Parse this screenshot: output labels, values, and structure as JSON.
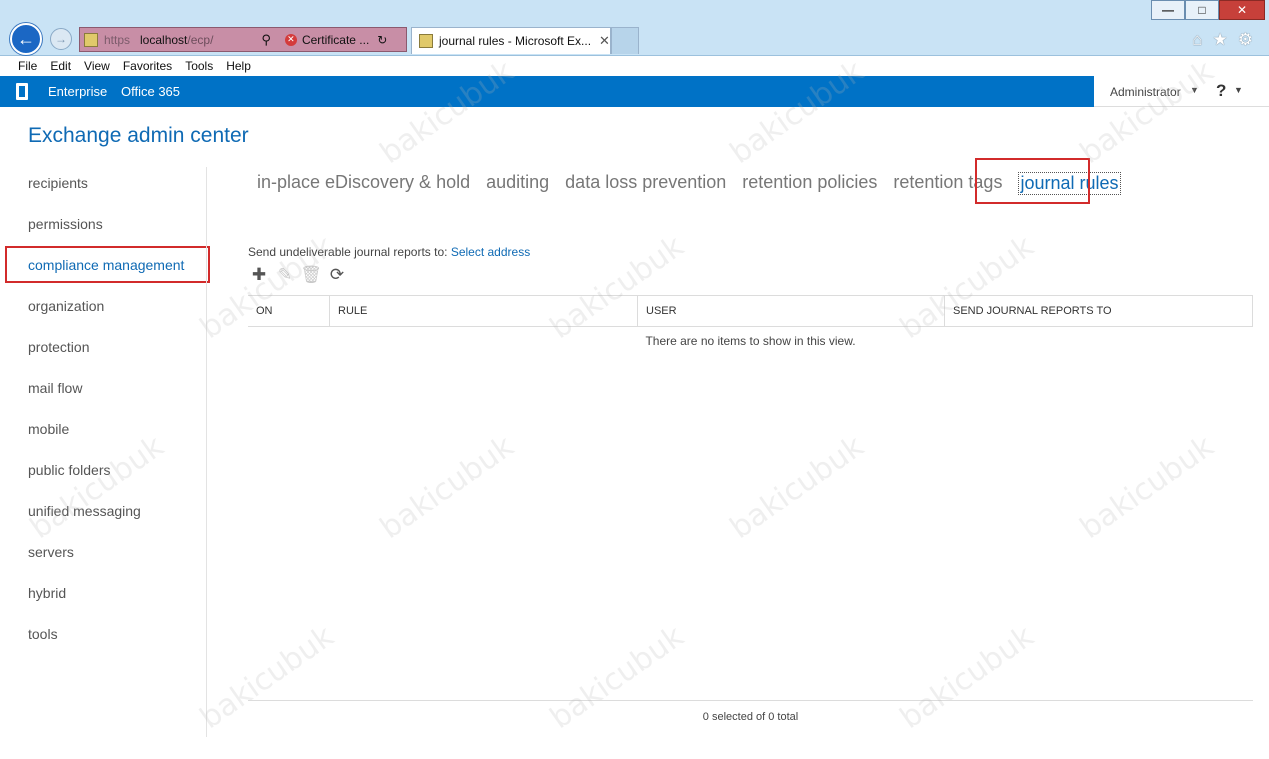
{
  "browser": {
    "address_proto": "https",
    "address_host": "localhost",
    "address_path": "/ecp/",
    "cert_label": "Certificate ...",
    "tab_title": "journal rules - Microsoft Ex...",
    "menu": [
      "File",
      "Edit",
      "View",
      "Favorites",
      "Tools",
      "Help"
    ]
  },
  "topbar": {
    "enterprise": "Enterprise",
    "office365": "Office 365",
    "user": "Administrator",
    "help": "?"
  },
  "app": {
    "title": "Exchange admin center"
  },
  "leftnav": {
    "items": [
      {
        "label": "recipients"
      },
      {
        "label": "permissions"
      },
      {
        "label": "compliance management"
      },
      {
        "label": "organization"
      },
      {
        "label": "protection"
      },
      {
        "label": "mail flow"
      },
      {
        "label": "mobile"
      },
      {
        "label": "public folders"
      },
      {
        "label": "unified messaging"
      },
      {
        "label": "servers"
      },
      {
        "label": "hybrid"
      },
      {
        "label": "tools"
      }
    ],
    "active_index": 2
  },
  "subtabs": [
    {
      "label": "in-place eDiscovery & hold"
    },
    {
      "label": "auditing"
    },
    {
      "label": "data loss prevention"
    },
    {
      "label": "retention policies"
    },
    {
      "label": "retention tags"
    },
    {
      "label": "journal rules"
    }
  ],
  "journal": {
    "undeliverable_label": "Send undeliverable journal reports to:",
    "select_address": "Select address",
    "columns": [
      "ON",
      "RULE",
      "USER",
      "SEND JOURNAL REPORTS TO"
    ],
    "empty_message": "There are no items to show in this view.",
    "status": "0 selected of 0 total"
  },
  "watermark": "bakicubuk"
}
